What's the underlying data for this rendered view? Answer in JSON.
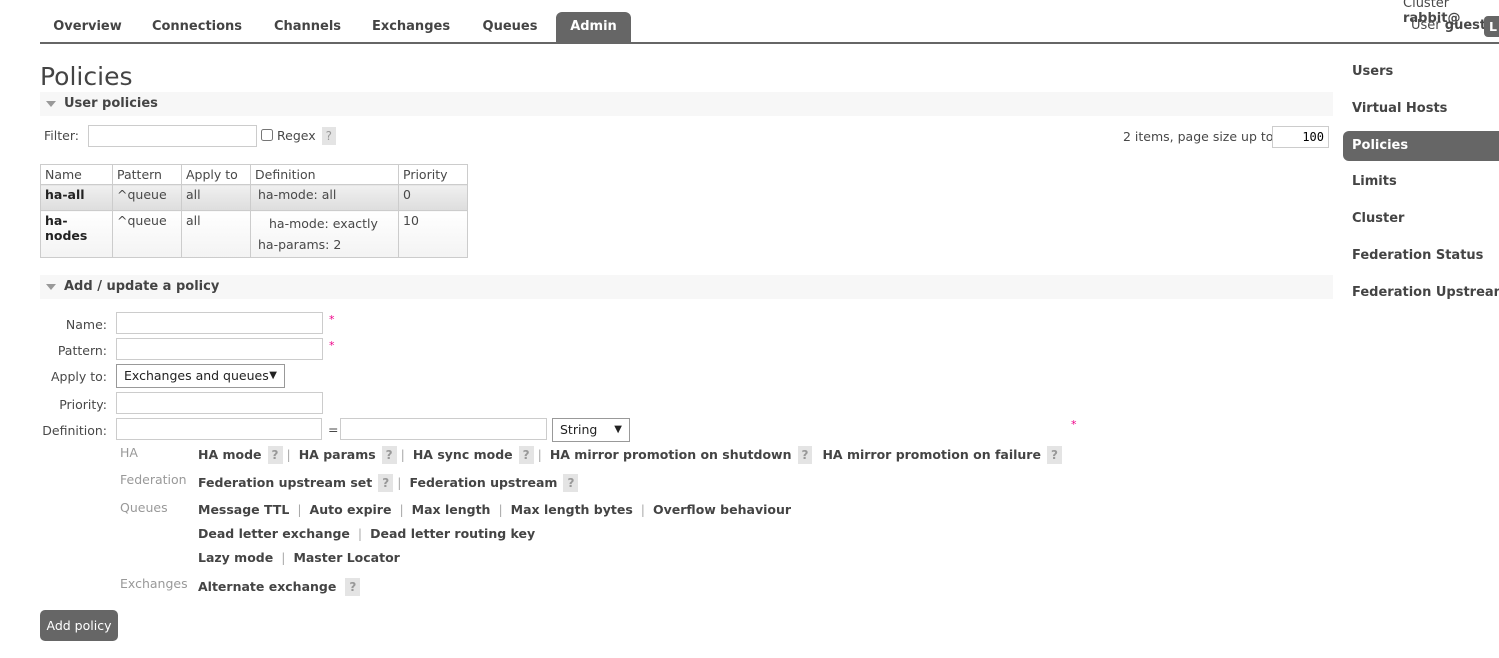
{
  "nav": {
    "tabs": [
      "Overview",
      "Connections",
      "Channels",
      "Exchanges",
      "Queues",
      "Admin"
    ],
    "active": "Admin"
  },
  "header": {
    "cluster_label": "Cluster",
    "cluster_name": "rabbit@",
    "user_label": "User",
    "user_name": "guest",
    "logout_label": "L"
  },
  "page_title": "Policies",
  "user_policies": {
    "title": "User policies",
    "filter_label": "Filter:",
    "filter_value": "",
    "regex_label": "Regex",
    "help": "?",
    "paging_text": "2 items, page size up to",
    "page_size": "100",
    "columns": [
      "Name",
      "Pattern",
      "Apply to",
      "Definition",
      "Priority"
    ],
    "rows": [
      {
        "name": "ha-all",
        "pattern": "^queue",
        "apply_to": "all",
        "definition": [
          {
            "key": "ha-mode:",
            "value": "all"
          }
        ],
        "priority": "0"
      },
      {
        "name": "ha-nodes",
        "pattern": "^queue",
        "apply_to": "all",
        "definition": [
          {
            "key": "ha-mode:",
            "value": "exactly"
          },
          {
            "key": "ha-params:",
            "value": "2"
          }
        ],
        "priority": "10"
      }
    ]
  },
  "add_policy": {
    "title": "Add / update a policy",
    "name_label": "Name:",
    "pattern_label": "Pattern:",
    "apply_to_label": "Apply to:",
    "apply_to_value": "Exchanges and queues",
    "priority_label": "Priority:",
    "definition_label": "Definition:",
    "equals": "=",
    "type_value": "String",
    "required": "*",
    "groups": {
      "ha": {
        "label": "HA",
        "items": [
          "HA mode",
          "HA params",
          "HA sync mode",
          "HA mirror promotion on shutdown",
          "HA mirror promotion on failure"
        ]
      },
      "federation": {
        "label": "Federation",
        "items": [
          "Federation upstream set",
          "Federation upstream"
        ]
      },
      "queues": {
        "label": "Queues",
        "items": [
          "Message TTL",
          "Auto expire",
          "Max length",
          "Max length bytes",
          "Overflow behaviour",
          "Dead letter exchange",
          "Dead letter routing key",
          "Lazy mode",
          "Master Locator"
        ]
      },
      "exchanges": {
        "label": "Exchanges",
        "items": [
          "Alternate exchange"
        ]
      }
    },
    "submit_label": "Add policy"
  },
  "sidebar": {
    "items": [
      "Users",
      "Virtual Hosts",
      "Policies",
      "Limits",
      "Cluster",
      "Federation Status",
      "Federation Upstreams"
    ],
    "active": "Policies"
  }
}
